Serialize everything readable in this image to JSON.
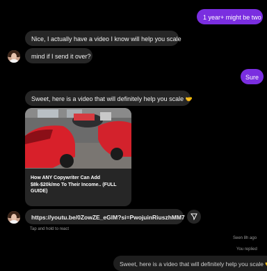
{
  "messages": {
    "m1": "1 year+ might be two",
    "m2": "Nice, I actually have a video I know will help you scale",
    "m3": "mind if I send it over?",
    "m4": "Sure",
    "m5": "Sweet, here is a video that will definitely help you scale",
    "m5_emoji": "🤝",
    "link": "https://youtu.be/0ZowZE_eGlM?si=PwojuinRiuszhMM7"
  },
  "video_card": {
    "title": "How ANY Copywriter Can Add $8k-$20k/mo To Their Income.. (FULL GUIDE)"
  },
  "hints": {
    "tap_hold": "Tap and hold to react",
    "seen": "Seen 8h ago",
    "you_replied": "You replied"
  },
  "reply_preview": {
    "text": "Sweet, here is a video that will definitely help you scale",
    "emoji": "🤝"
  },
  "colors": {
    "outgoing_bubble": "#7a2ee0",
    "incoming_bubble": "#262626",
    "background": "#000000"
  }
}
